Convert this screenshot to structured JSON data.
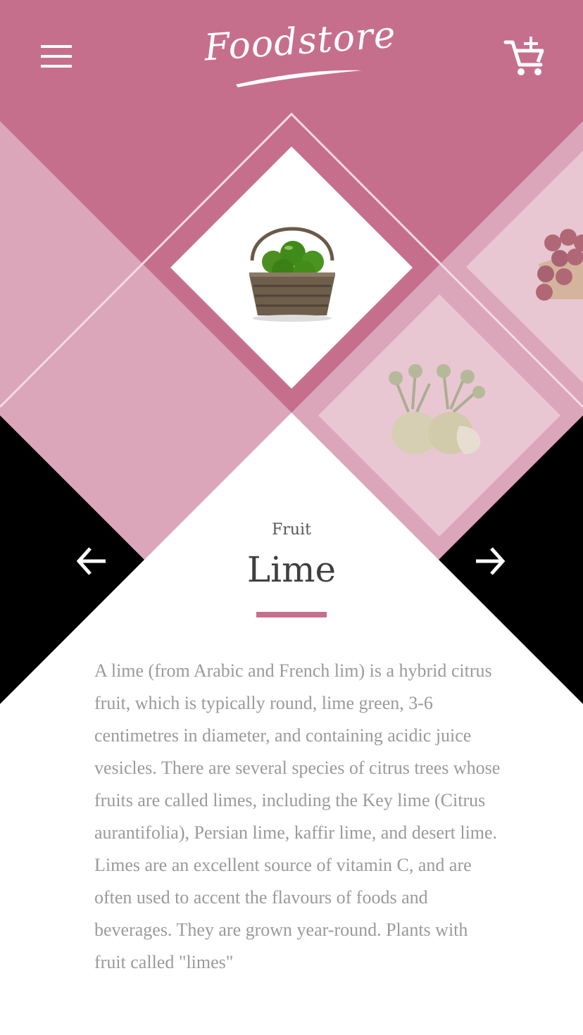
{
  "app": {
    "brand": "Foodstore"
  },
  "colors": {
    "primary": "#c66f8c",
    "light": "#dba6b9",
    "lighter": "#e8c7d3",
    "dark": "#000000",
    "text": "#9a9a9a"
  },
  "header": {
    "menu_icon": "hamburger-menu-icon",
    "cart_icon": "add-to-cart-icon"
  },
  "product": {
    "category": "Fruit",
    "name": "Lime",
    "image": "basket-of-limes",
    "description": "A lime (from Arabic and French lim) is a hybrid citrus fruit, which is typically round, lime green, 3-6 centimetres in diameter, and containing acidic juice vesicles. There are several species of citrus trees whose fruits are called limes, including the Key lime (Citrus aurantifolia), Persian lime, kaffir lime, and desert lime. Limes are an excellent source of vitamin C, and are often used to accent the flavours of foods and beverages. They are grown year-round. Plants with fruit called \"limes\""
  },
  "carousel": {
    "next_item_image": "kohlrabi",
    "far_item_image": "plums",
    "prev_icon": "arrow-left-icon",
    "next_icon": "arrow-right-icon"
  }
}
